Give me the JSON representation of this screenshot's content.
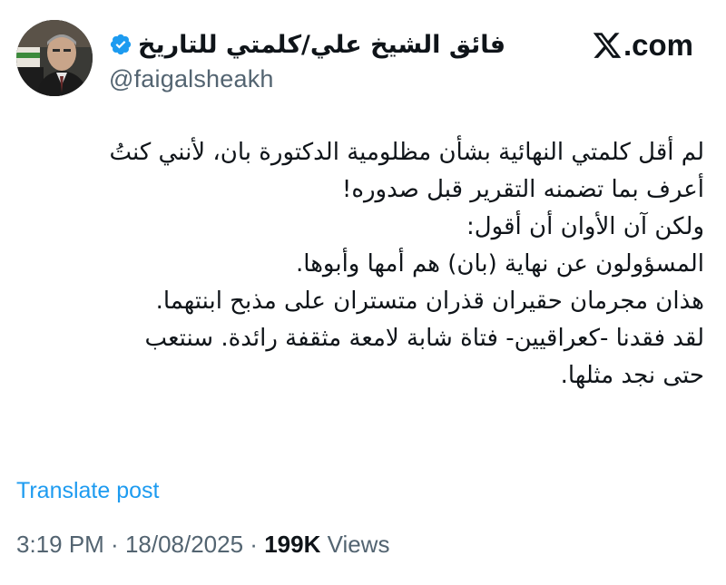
{
  "author": {
    "display_name": "فائق الشيخ علي/كلمتي للتاريخ",
    "handle": "@faigalsheakh",
    "verified": true
  },
  "brand": {
    "logo_text": ".com",
    "logo_icon": "x-logo-icon"
  },
  "post": {
    "lines": [
      "لم أقل كلمتي النهائية بشأن مظلومية الدكتورة بان، لأنني كنتُ",
      "أعرف بما تضمنه التقرير قبل صدوره!",
      "ولكن آن الأوان أن أقول:",
      "المسؤولون عن نهاية (بان) هم أمها وأبوها.",
      "هذان مجرمان حقيران قذران متستران على مذبح ابنتهما.",
      "لقد فقدنا -كعراقيين- فتاة شابة لامعة مثقفة رائدة. سنتعب",
      "حتى نجد مثلها."
    ]
  },
  "actions": {
    "translate_label": "Translate post"
  },
  "meta": {
    "time": "3:19 PM",
    "separator": " · ",
    "date": "18/08/2025",
    "views_count": "199K",
    "views_label": " Views"
  },
  "colors": {
    "accent": "#1d9bf0",
    "text": "#0f1419",
    "secondary": "#536471"
  }
}
